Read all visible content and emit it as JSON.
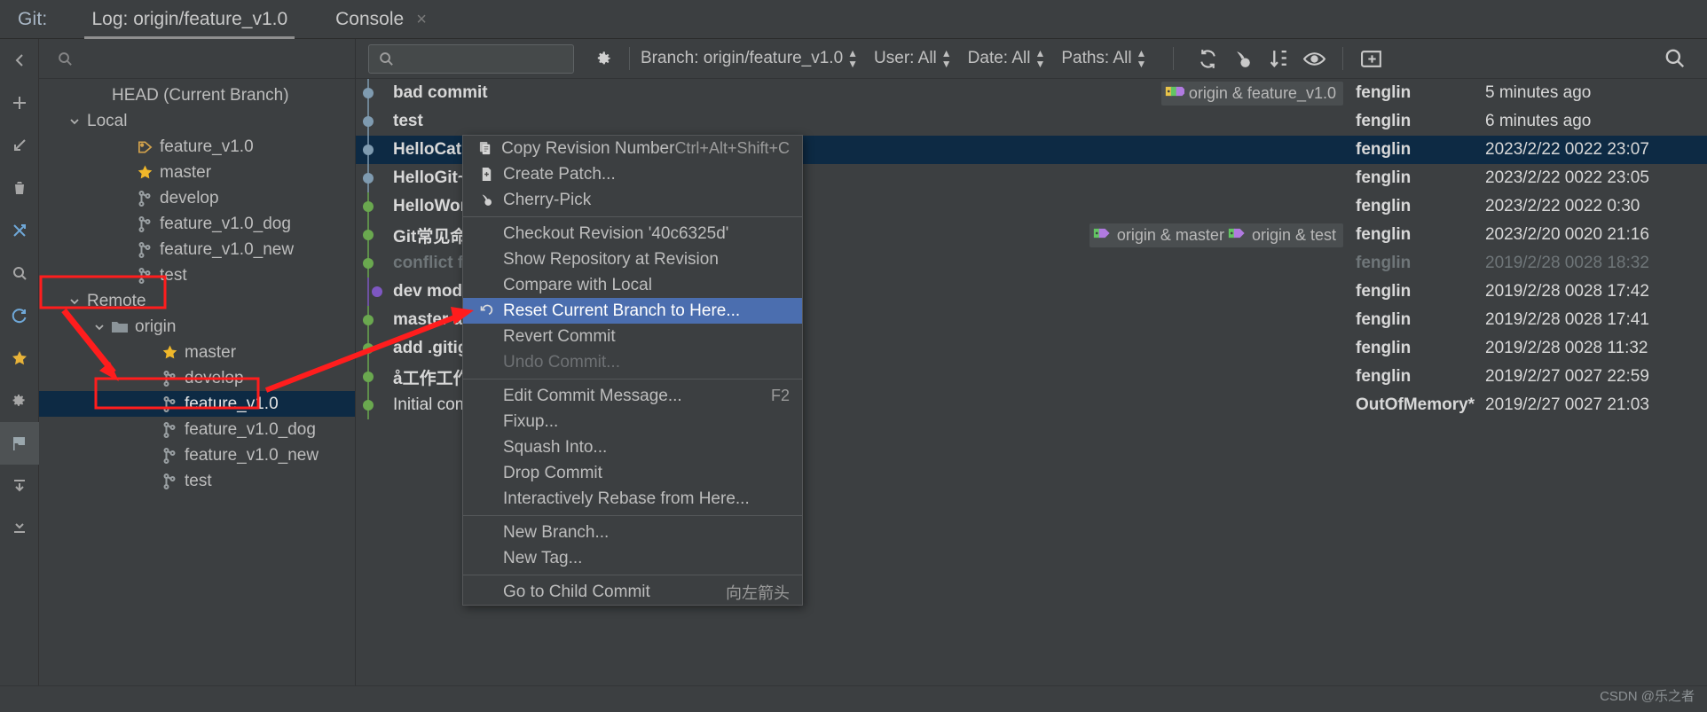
{
  "tabbar": {
    "git_label": "Git:",
    "tabs": [
      {
        "label": "Log: origin/feature_v1.0",
        "active": true
      },
      {
        "label": "Console",
        "active": false
      }
    ],
    "close_icon": "×"
  },
  "rail": {
    "items": [
      {
        "name": "collapse-left-icon"
      },
      {
        "name": "add-icon"
      },
      {
        "name": "arrow-down-left-icon"
      },
      {
        "name": "trash-icon"
      },
      {
        "name": "merge-icon"
      },
      {
        "name": "search-icon"
      },
      {
        "name": "refresh-icon"
      },
      {
        "name": "star-icon"
      },
      {
        "name": "settings-icon"
      },
      {
        "name": "flag-icon"
      },
      {
        "name": "expand-all-icon"
      },
      {
        "name": "collapse-all-icon"
      }
    ]
  },
  "sidebar": {
    "search_placeholder": "",
    "tree": [
      {
        "label": "HEAD (Current Branch)",
        "indent": 1,
        "icon": "none",
        "chev": "none",
        "selected": false
      },
      {
        "label": "Local",
        "indent": 0,
        "icon": "none",
        "chev": "down",
        "selected": false
      },
      {
        "label": "feature_v1.0",
        "indent": 2,
        "icon": "tag",
        "chev": "none",
        "selected": false
      },
      {
        "label": "master",
        "indent": 2,
        "icon": "star",
        "chev": "none",
        "selected": false
      },
      {
        "label": "develop",
        "indent": 2,
        "icon": "branch",
        "chev": "none",
        "selected": false
      },
      {
        "label": "feature_v1.0_dog",
        "indent": 2,
        "icon": "branch",
        "chev": "none",
        "selected": false
      },
      {
        "label": "feature_v1.0_new",
        "indent": 2,
        "icon": "branch",
        "chev": "none",
        "selected": false
      },
      {
        "label": "test",
        "indent": 2,
        "icon": "branch",
        "chev": "none",
        "selected": false
      },
      {
        "label": "Remote",
        "indent": 0,
        "icon": "none",
        "chev": "down",
        "selected": false
      },
      {
        "label": "origin",
        "indent": 1,
        "icon": "folder",
        "chev": "down",
        "selected": false
      },
      {
        "label": "master",
        "indent": 3,
        "icon": "star",
        "chev": "none",
        "selected": false
      },
      {
        "label": "develop",
        "indent": 3,
        "icon": "branch",
        "chev": "none",
        "selected": false
      },
      {
        "label": "feature_v1.0",
        "indent": 3,
        "icon": "branch",
        "chev": "none",
        "selected": true
      },
      {
        "label": "feature_v1.0_dog",
        "indent": 3,
        "icon": "branch",
        "chev": "none",
        "selected": false
      },
      {
        "label": "feature_v1.0_new",
        "indent": 3,
        "icon": "branch",
        "chev": "none",
        "selected": false
      },
      {
        "label": "test",
        "indent": 3,
        "icon": "branch",
        "chev": "none",
        "selected": false
      }
    ]
  },
  "log_toolbar": {
    "search_placeholder": "",
    "search_value": "",
    "filters": [
      {
        "name": "branch-filter",
        "label": "Branch: origin/feature_v1.0"
      },
      {
        "name": "user-filter",
        "label": "User: All"
      },
      {
        "name": "date-filter",
        "label": "Date: All"
      },
      {
        "name": "paths-filter",
        "label": "Paths: All"
      }
    ],
    "icons": [
      {
        "name": "refresh-icon"
      },
      {
        "name": "cherry-pick-icon"
      },
      {
        "name": "sort-icon"
      },
      {
        "name": "show-details-icon"
      },
      {
        "name": "intellisort-icon"
      }
    ],
    "search_right_icon": "search-icon"
  },
  "commits": [
    {
      "subject": "bad commit",
      "node_color": "#7f9bb0",
      "refs": [
        {
          "label": "origin & feature_v1.0",
          "tag_colors": [
            "#e8c349",
            "#62c462",
            "#b07ae0"
          ]
        }
      ],
      "author": "fenglin",
      "date": "5 minutes ago",
      "selected": false,
      "dim": false,
      "bold": true
    },
    {
      "subject": "test",
      "node_color": "#7f9bb0",
      "refs": [],
      "author": "fenglin",
      "date": "6 minutes ago",
      "selected": false,
      "dim": false,
      "bold": true
    },
    {
      "subject": "HelloCat",
      "node_color": "#7f9bb0",
      "refs": [],
      "author": "fenglin",
      "date": "2023/2/22 0022 23:07",
      "selected": true,
      "dim": false,
      "bold": true
    },
    {
      "subject": "HelloGit~",
      "node_color": "#7f9bb0",
      "refs": [],
      "author": "fenglin",
      "date": "2023/2/22 0022 23:05",
      "selected": false,
      "dim": false,
      "bold": true
    },
    {
      "subject": "HelloWor",
      "node_color": "#6aa84f",
      "refs": [],
      "author": "fenglin",
      "date": "2023/2/22 0022 0:30",
      "selected": false,
      "dim": false,
      "bold": true
    },
    {
      "subject": "Git常见命",
      "node_color": "#6aa84f",
      "refs": [
        {
          "label": "origin & master",
          "tag_colors": [
            "#62c462",
            "#b07ae0"
          ]
        },
        {
          "label": "origin & test",
          "tag_colors": [
            "#62c462",
            "#b07ae0"
          ]
        }
      ],
      "author": "fenglin",
      "date": "2023/2/20 0020 21:16",
      "selected": false,
      "dim": false,
      "bold": true
    },
    {
      "subject": "conflict fi",
      "node_color": "#6aa84f",
      "refs": [],
      "author": "fenglin",
      "date": "2019/2/28 0028 18:32",
      "selected": false,
      "dim": true,
      "bold": true
    },
    {
      "subject": "dev modi",
      "node_color": "#7e57c2",
      "refs": [],
      "author": "fenglin",
      "date": "2019/2/28 0028 17:42",
      "selected": false,
      "dim": false,
      "bold": true
    },
    {
      "subject": "master a",
      "node_color": "#6aa84f",
      "refs": [],
      "author": "fenglin",
      "date": "2019/2/28 0028 17:41",
      "selected": false,
      "dim": false,
      "bold": true
    },
    {
      "subject": "add .gitig",
      "node_color": "#6aa84f",
      "refs": [],
      "author": "fenglin",
      "date": "2019/2/28 0028 11:32",
      "selected": false,
      "dim": false,
      "bold": true
    },
    {
      "subject": "å工作工作",
      "node_color": "#6aa84f",
      "refs": [],
      "author": "fenglin",
      "date": "2019/2/27 0027 22:59",
      "selected": false,
      "dim": false,
      "bold": true
    },
    {
      "subject": "Initial com",
      "node_color": "#6aa84f",
      "refs": [],
      "author": "OutOfMemory*",
      "date": "2019/2/27 0027 21:03",
      "selected": false,
      "dim": false,
      "bold": false
    }
  ],
  "context_menu": {
    "items": [
      {
        "label": "Copy Revision Number",
        "shortcut": "Ctrl+Alt+Shift+C",
        "icon": "copy-icon",
        "state": "normal"
      },
      {
        "label": "Create Patch...",
        "shortcut": "",
        "icon": "patch-icon",
        "state": "normal"
      },
      {
        "label": "Cherry-Pick",
        "shortcut": "",
        "icon": "cherry-pick-icon",
        "state": "normal"
      },
      {
        "separator": true
      },
      {
        "label": "Checkout Revision '40c6325d'",
        "shortcut": "",
        "icon": "none",
        "state": "normal"
      },
      {
        "label": "Show Repository at Revision",
        "shortcut": "",
        "icon": "none",
        "state": "normal"
      },
      {
        "label": "Compare with Local",
        "shortcut": "",
        "icon": "none",
        "state": "normal"
      },
      {
        "label": "Reset Current Branch to Here...",
        "shortcut": "",
        "icon": "reset-icon",
        "state": "highlight"
      },
      {
        "label": "Revert Commit",
        "shortcut": "",
        "icon": "none",
        "state": "normal"
      },
      {
        "label": "Undo Commit...",
        "shortcut": "",
        "icon": "none",
        "state": "disabled"
      },
      {
        "separator": true
      },
      {
        "label": "Edit Commit Message...",
        "shortcut": "F2",
        "icon": "none",
        "state": "normal"
      },
      {
        "label": "Fixup...",
        "shortcut": "",
        "icon": "none",
        "state": "normal"
      },
      {
        "label": "Squash Into...",
        "shortcut": "",
        "icon": "none",
        "state": "normal"
      },
      {
        "label": "Drop Commit",
        "shortcut": "",
        "icon": "none",
        "state": "normal"
      },
      {
        "label": "Interactively Rebase from Here...",
        "shortcut": "",
        "icon": "none",
        "state": "normal"
      },
      {
        "separator": true
      },
      {
        "label": "New Branch...",
        "shortcut": "",
        "icon": "none",
        "state": "normal"
      },
      {
        "label": "New Tag...",
        "shortcut": "",
        "icon": "none",
        "state": "normal"
      },
      {
        "separator": true
      },
      {
        "label": "Go to Child Commit",
        "shortcut": "向左箭头",
        "icon": "none",
        "state": "normal"
      }
    ]
  },
  "annotations": {
    "color": "#ff1d1d"
  },
  "watermark": {
    "text": "CSDN @乐之者"
  }
}
